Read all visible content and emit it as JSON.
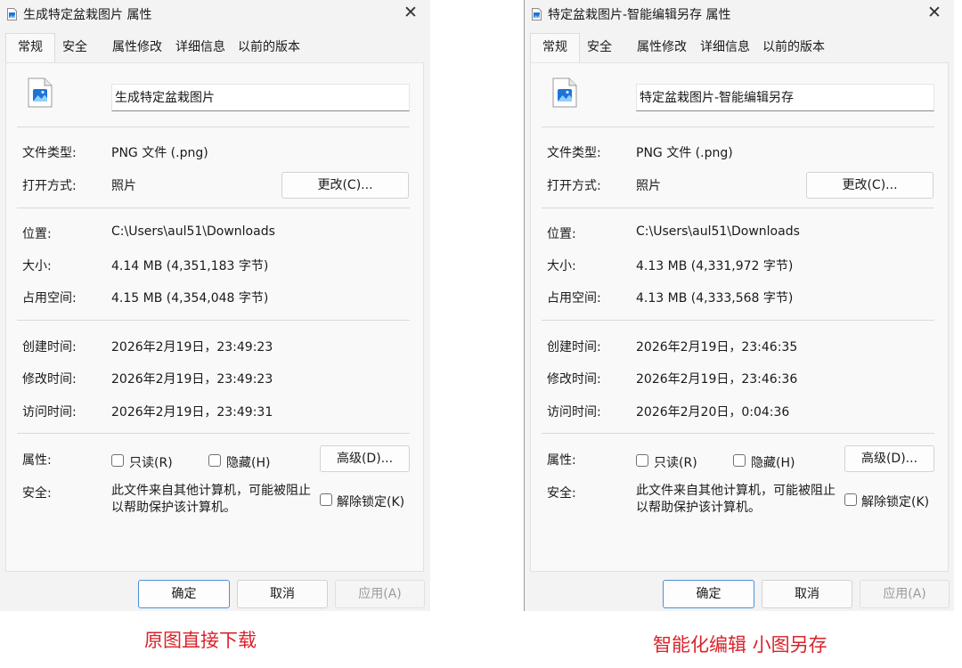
{
  "windows": [
    {
      "title": "生成特定盆栽图片 属性",
      "close_symbol": "✕",
      "tabs": [
        "常规",
        "安全",
        "属性修改",
        "详细信息",
        "以前的版本"
      ],
      "active_tab": "常规",
      "file_name": "生成特定盆栽图片",
      "file_type_label": "文件类型:",
      "file_type": "PNG 文件 (.png)",
      "open_with_label": "打开方式:",
      "open_with": "照片",
      "change_button": "更改(C)...",
      "location_label": "位置:",
      "location": "C:\\Users\\aul51\\Downloads",
      "size_label": "大小:",
      "size": "4.14 MB (4,351,183 字节)",
      "size_on_disk_label": "占用空间:",
      "size_on_disk": "4.15 MB (4,354,048 字节)",
      "created_label": "创建时间:",
      "created": "2026年2月19日，23:49:23",
      "modified_label": "修改时间:",
      "modified": "2026年2月19日，23:49:23",
      "accessed_label": "访问时间:",
      "accessed": "2026年2月19日，23:49:31",
      "attributes_label": "属性:",
      "readonly_label": "只读(R)",
      "hidden_label": "隐藏(H)",
      "advanced_button": "高级(D)...",
      "security_label": "安全:",
      "security_text": "此文件来自其他计算机，可能被阻止以帮助保护该计算机。",
      "unblock_label": "解除锁定(K)",
      "ok_button": "确定",
      "cancel_button": "取消",
      "apply_button": "应用(A)"
    },
    {
      "title": "特定盆栽图片-智能编辑另存 属性",
      "close_symbol": "✕",
      "tabs": [
        "常规",
        "安全",
        "属性修改",
        "详细信息",
        "以前的版本"
      ],
      "active_tab": "常规",
      "file_name": "特定盆栽图片-智能编辑另存",
      "file_type_label": "文件类型:",
      "file_type": "PNG 文件 (.png)",
      "open_with_label": "打开方式:",
      "open_with": "照片",
      "change_button": "更改(C)...",
      "location_label": "位置:",
      "location": "C:\\Users\\aul51\\Downloads",
      "size_label": "大小:",
      "size": "4.13 MB (4,331,972 字节)",
      "size_on_disk_label": "占用空间:",
      "size_on_disk": "4.13 MB (4,333,568 字节)",
      "created_label": "创建时间:",
      "created": "2026年2月19日，23:46:35",
      "modified_label": "修改时间:",
      "modified": "2026年2月19日，23:46:36",
      "accessed_label": "访问时间:",
      "accessed": "2026年2月20日，0:04:36",
      "attributes_label": "属性:",
      "readonly_label": "只读(R)",
      "hidden_label": "隐藏(H)",
      "advanced_button": "高级(D)...",
      "security_label": "安全:",
      "security_text": "此文件来自其他计算机，可能被阻止以帮助保护该计算机。",
      "unblock_label": "解除锁定(K)",
      "ok_button": "确定",
      "cancel_button": "取消",
      "apply_button": "应用(A)"
    }
  ],
  "captions": {
    "left": "原图直接下载",
    "right": "智能化编辑  小图另存"
  },
  "icons": {
    "title_icon": "image-file-icon",
    "file_icon": "png-image-file-icon",
    "close": "close-icon"
  },
  "colors": {
    "caption": "#d8232a",
    "primary_button_border": "#4c8fd6",
    "image_icon_blue": "#1e73d8"
  }
}
